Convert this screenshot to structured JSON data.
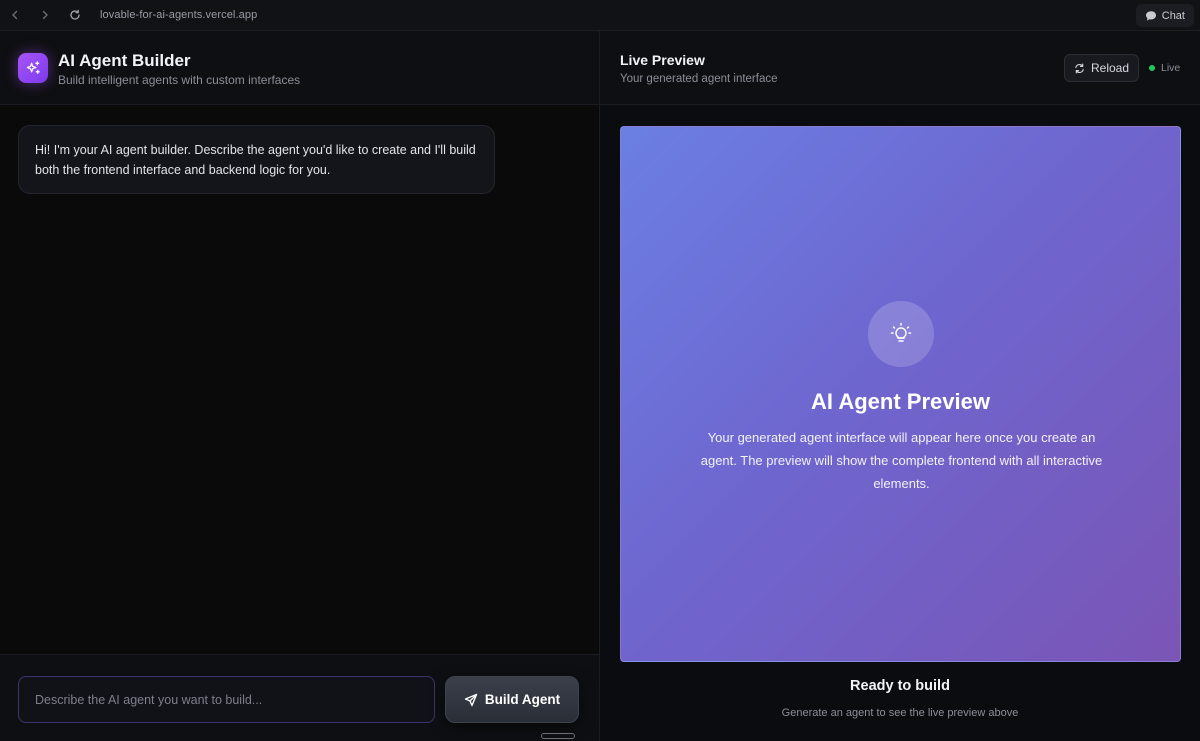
{
  "browser": {
    "url": "lovable-for-ai-agents.vercel.app",
    "chat_label": "Chat"
  },
  "builder": {
    "title": "AI Agent Builder",
    "subtitle": "Build intelligent agents with custom interfaces",
    "messages": [
      {
        "role": "assistant",
        "text": "Hi! I'm your AI agent builder. Describe the agent you'd like to create and I'll build both the frontend interface and backend logic for you."
      }
    ],
    "input_placeholder": "Describe the AI agent you want to build...",
    "input_value": "",
    "build_button_label": "Build Agent"
  },
  "preview": {
    "title": "Live Preview",
    "subtitle": "Your generated agent interface",
    "reload_label": "Reload",
    "status_label": "Live",
    "status_color": "#22c55e",
    "canvas": {
      "heading": "AI Agent Preview",
      "description": "Your generated agent interface will appear here once you create an agent. The preview will show the complete frontend with all interactive elements.",
      "gradient_start": "#6b7fe3",
      "gradient_end": "#7a55b5"
    },
    "ready_title": "Ready to build",
    "ready_subtitle": "Generate an agent to see the live preview above"
  },
  "icons": {
    "back": "chevron-left-icon",
    "forward": "chevron-right-icon",
    "refresh": "refresh-icon",
    "chat": "chat-bubble-icon",
    "logo": "sparkles-icon",
    "send": "send-icon",
    "reload": "reload-icon",
    "preview": "lightbulb-icon"
  }
}
